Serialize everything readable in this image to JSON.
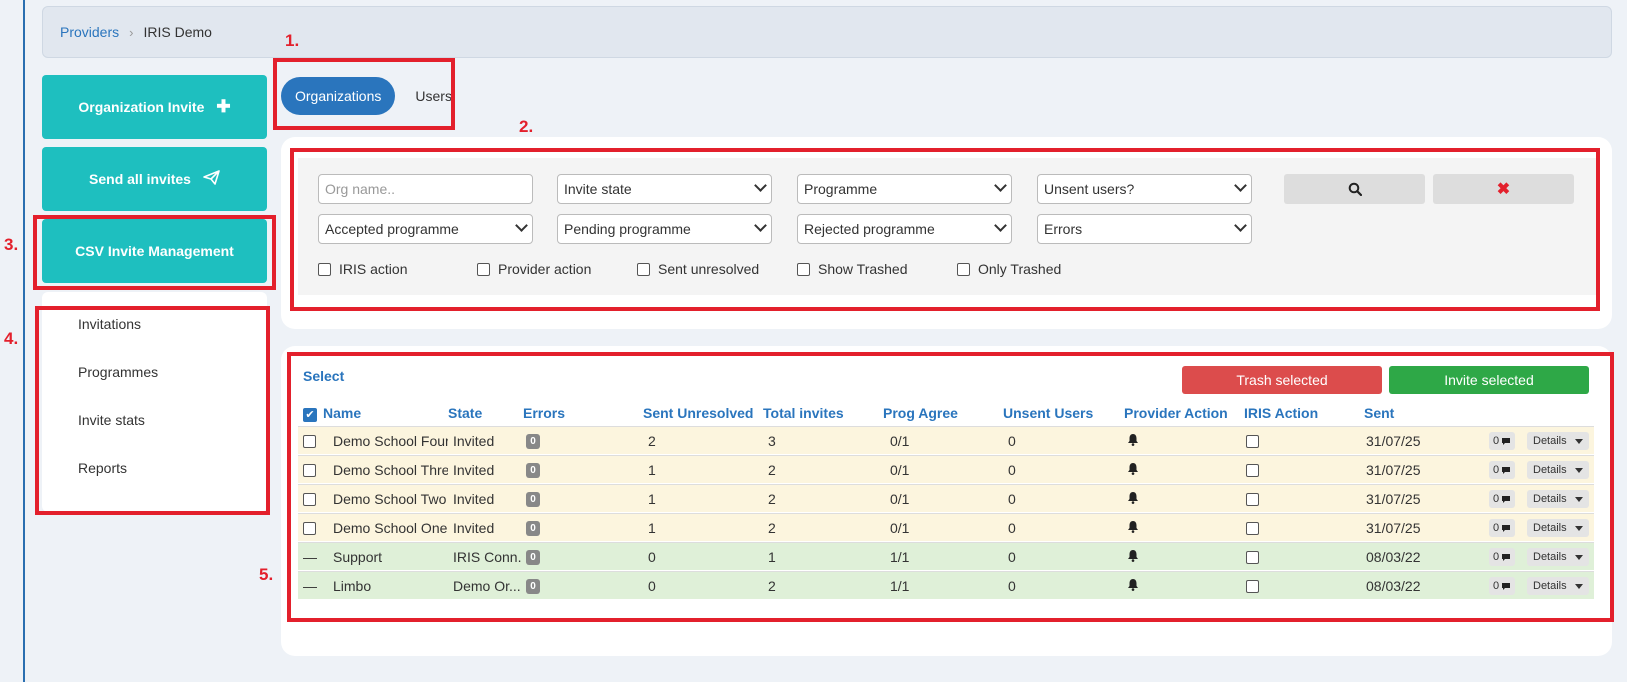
{
  "breadcrumb": {
    "root": "Providers",
    "current": "IRIS Demo"
  },
  "markers": [
    "1.",
    "2.",
    "3.",
    "4.",
    "5."
  ],
  "side_buttons": [
    {
      "label": "Organization Invite",
      "icon": "plus-icon"
    },
    {
      "label": "Send all invites",
      "icon": "paper-plane-icon"
    },
    {
      "label": "CSV Invite Management"
    }
  ],
  "side_menu": [
    "Invitations",
    "Programmes",
    "Invite stats",
    "Reports"
  ],
  "tabs": [
    {
      "label": "Organizations",
      "active": true
    },
    {
      "label": "Users",
      "active": false
    }
  ],
  "filters": {
    "org_name_placeholder": "Org name..",
    "selects": [
      "Invite state",
      "Programme",
      "Unsent users?",
      "Accepted programme",
      "Pending programme",
      "Rejected programme",
      "Errors"
    ],
    "checkboxes": [
      "IRIS action",
      "Provider action",
      "Sent unresolved",
      "Show Trashed",
      "Only Trashed"
    ]
  },
  "table": {
    "select_label": "Select",
    "trash_label": "Trash selected",
    "invite_label": "Invite selected",
    "headers": [
      "Name",
      "State",
      "Errors",
      "Sent Unresolved",
      "Total invites",
      "Prog Agree",
      "Unsent Users",
      "Provider Action",
      "IRIS Action",
      "Sent"
    ],
    "details_label": "Details",
    "rows": [
      {
        "name": "Demo School Four",
        "state": "Invited",
        "errors": "0",
        "sent_unresolved": "2",
        "total": "3",
        "prog": "0/1",
        "unsent": "0",
        "sent": "31/07/25",
        "comments": "0",
        "status": "invited"
      },
      {
        "name": "Demo School Three",
        "state": "Invited",
        "errors": "0",
        "sent_unresolved": "1",
        "total": "2",
        "prog": "0/1",
        "unsent": "0",
        "sent": "31/07/25",
        "comments": "0",
        "status": "invited"
      },
      {
        "name": "Demo School Two",
        "state": "Invited",
        "errors": "0",
        "sent_unresolved": "1",
        "total": "2",
        "prog": "0/1",
        "unsent": "0",
        "sent": "31/07/25",
        "comments": "0",
        "status": "invited"
      },
      {
        "name": "Demo School One",
        "state": "Invited",
        "errors": "0",
        "sent_unresolved": "1",
        "total": "2",
        "prog": "0/1",
        "unsent": "0",
        "sent": "31/07/25",
        "comments": "0",
        "status": "invited"
      },
      {
        "name": "Support",
        "state": "IRIS Conn...",
        "errors": "0",
        "sent_unresolved": "0",
        "total": "1",
        "prog": "1/1",
        "unsent": "0",
        "sent": "08/03/22",
        "comments": "0",
        "status": "done"
      },
      {
        "name": "Limbo",
        "state": "Demo Or...",
        "errors": "0",
        "sent_unresolved": "0",
        "total": "2",
        "prog": "1/1",
        "unsent": "0",
        "sent": "08/03/22",
        "comments": "0",
        "status": "done"
      }
    ]
  },
  "colors": {
    "accent": "#2a75bd",
    "teal": "#1ebfbf",
    "annotation": "#e3202c",
    "trash": "#dc4c4c",
    "invite": "#2ea847"
  }
}
